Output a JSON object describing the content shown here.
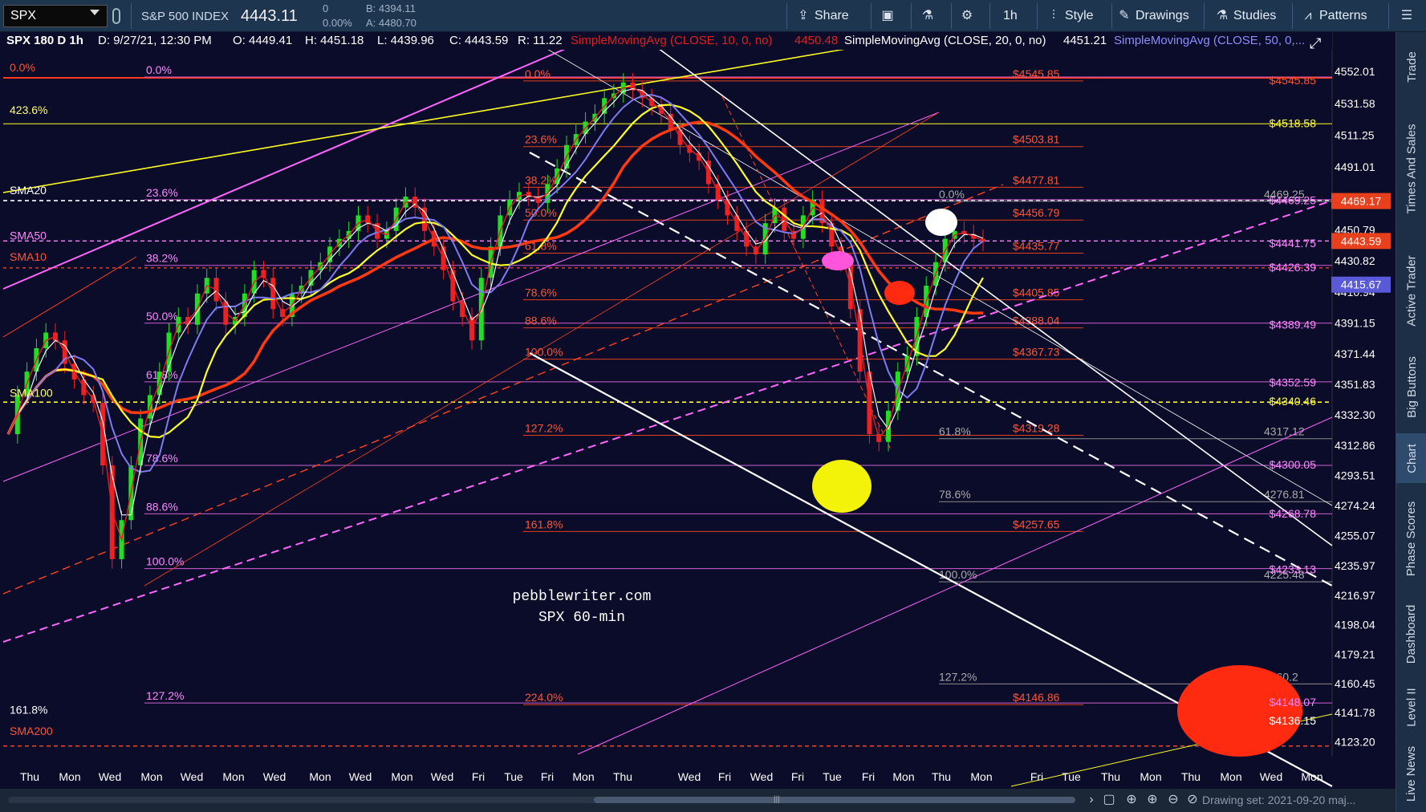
{
  "toolbar": {
    "symbol": "SPX",
    "index_name": "S&P 500 INDEX",
    "last_price": "4443.11",
    "change": "0",
    "change_pct": "0.00%",
    "bid": "B: 4394.11",
    "ask": "A: 4480.70",
    "buttons": {
      "share": "Share",
      "timeframe": "1h",
      "style": "Style",
      "drawings": "Drawings",
      "studies": "Studies",
      "patterns": "Patterns"
    }
  },
  "info_bar": {
    "study_label": "SPX 180 D 1h",
    "date": "D: 9/27/21, 12:30 PM",
    "open": "O: 4449.41",
    "high": "H: 4451.18",
    "low": "L: 4439.96",
    "close": "C: 4443.59",
    "range": "R: 11.22",
    "sma10": "SimpleMovingAvg (CLOSE, 10, 0, no)",
    "sma10_val": "4450.48",
    "sma20": "SimpleMovingAvg (CLOSE, 20, 0, no)",
    "sma20_val": "4451.21",
    "sma50": "SimpleMovingAvg (CLOSE, 50, 0,..."
  },
  "colors": {
    "background": "#0b0b2a",
    "price": "#e8e8e8",
    "sma10": "#e02020",
    "sma20": "#f4f4f4",
    "sma50": "#7c7cf0",
    "sma100": "#ffff22",
    "sma200": "#ff4010",
    "fib_orange": "#ff5522",
    "fib_pink": "#ff66ff",
    "fib_gray": "#9a9a9a",
    "channel_white": "#ffffff"
  },
  "chart_data": {
    "type": "candlestick",
    "title": "",
    "ylim": [
      4108,
      4567
    ],
    "y_ticks": [
      4552.01,
      4531.58,
      4511.25,
      4491.01,
      4470.86,
      4450.79,
      4430.82,
      4410.94,
      4391.15,
      4371.44,
      4351.83,
      4332.3,
      4312.86,
      4293.51,
      4274.24,
      4255.07,
      4235.97,
      4216.97,
      4198.04,
      4179.21,
      4160.45,
      4141.78,
      4123.2
    ],
    "x_labels": [
      "Thu",
      "Mon",
      "Wed",
      "Mon",
      "Wed",
      "Mon",
      "Wed",
      "Mon",
      "Wed",
      "Mon",
      "Wed",
      "Fri",
      "Tue",
      "Fri",
      "Mon",
      "Thu",
      "Wed",
      "Fri",
      "Wed",
      "Fri",
      "Tue",
      "Fri",
      "Mon",
      "Thu",
      "Mon",
      "Fri",
      "Tue",
      "Thu",
      "Mon",
      "Thu",
      "Mon",
      "Wed",
      "Mon"
    ],
    "price_tags": [
      {
        "label": "4469.17",
        "value": 4469.17,
        "color": "#e8401c"
      },
      {
        "label": "4443.59",
        "value": 4443.59,
        "color": "#e8401c"
      },
      {
        "label": "4415.67",
        "value": 4415.67,
        "color": "#5a5ad8"
      }
    ],
    "moving_averages": [
      {
        "name": "SMA10",
        "value": 4450.48
      },
      {
        "name": "SMA20",
        "value": 4451.21
      },
      {
        "name": "SMA50",
        "value": 4415.67
      }
    ],
    "horizontal_levels": [
      {
        "value": 4548,
        "color": "#ff3a1c",
        "width": 2,
        "dash": ""
      },
      {
        "value": 4518.58,
        "color": "#ffff22",
        "width": 1,
        "dash": ""
      },
      {
        "value": 4469.4,
        "color": "#ffffff",
        "width": 1.6,
        "dash": "5,4"
      },
      {
        "value": 4443.6,
        "color": "#ff88ff",
        "width": 1.4,
        "dash": "5,4"
      },
      {
        "value": 4426.4,
        "color": "#ff4a2a",
        "width": 1.2,
        "dash": "4,4"
      },
      {
        "value": 4340.46,
        "color": "#ffff22",
        "width": 1.6,
        "dash": "5,4"
      },
      {
        "value": 4120.4,
        "color": "#ff4a2a",
        "width": 1.4,
        "dash": "5,4"
      }
    ],
    "left_labels": [
      {
        "text": "0.0%",
        "value": 4552.0,
        "color": "#ff5533"
      },
      {
        "text": "423.6%",
        "value": 4525.0,
        "color": "#ffff66"
      },
      {
        "text": "SMA20",
        "value": 4473.5,
        "color": "#ffffff"
      },
      {
        "text": "SMA50",
        "value": 4444.5,
        "color": "#ff88ff"
      },
      {
        "text": "SMA10",
        "value": 4431.0,
        "color": "#ff5533"
      },
      {
        "text": "SMA100",
        "value": 4344.0,
        "color": "#ffff66"
      },
      {
        "text": "161.8%",
        "value": 4141.0,
        "color": "#ffffff"
      },
      {
        "text": "SMA200",
        "value": 4127.5,
        "color": "#ff5533"
      }
    ],
    "fib_pink": [
      {
        "pct": "0.0%",
        "value": 4548.5
      },
      {
        "pct": "23.6%",
        "value": 4470.0
      },
      {
        "pct": "38.2%",
        "value": 4428.0
      },
      {
        "pct": "50.0%",
        "value": 4391.0
      },
      {
        "pct": "61.8%",
        "value": 4353.5
      },
      {
        "pct": "78.6%",
        "value": 4300.0
      },
      {
        "pct": "88.6%",
        "value": 4269.0
      },
      {
        "pct": "100.0%",
        "value": 4234.0
      },
      {
        "pct": "127.2%",
        "value": 4148.0
      }
    ],
    "fib_orange": [
      {
        "pct": "0.0%",
        "value": 4546.0,
        "price": "$4545.85"
      },
      {
        "pct": "23.6%",
        "value": 4504.0,
        "price": "$4503.81"
      },
      {
        "pct": "38.2%",
        "value": 4478.0,
        "price": "$4477.81"
      },
      {
        "pct": "50.0%",
        "value": 4457.0,
        "price": "$4456.79"
      },
      {
        "pct": "61.8%",
        "value": 4435.8,
        "price": "$4435.77"
      },
      {
        "pct": "78.6%",
        "value": 4406.0,
        "price": "$4405.85"
      },
      {
        "pct": "88.6%",
        "value": 4388.0,
        "price": "$4388.04"
      },
      {
        "pct": "100.0%",
        "value": 4368.0,
        "price": "$4367.73"
      },
      {
        "pct": "127.2%",
        "value": 4319.3,
        "price": "$4319.28"
      },
      {
        "pct": "161.8%",
        "value": 4257.7,
        "price": "$4257.65"
      },
      {
        "pct": "224.0%",
        "value": 4146.9,
        "price": "$4146.86"
      }
    ],
    "fib_gray": [
      {
        "pct": "0.0%",
        "value": 4469.0,
        "price": "4469.25"
      },
      {
        "pct": "61.8%",
        "value": 4317.1,
        "price": "4317.12"
      },
      {
        "pct": "78.6%",
        "value": 4276.8,
        "price": "4276.81"
      },
      {
        "pct": "100.0%",
        "value": 4225.5,
        "price": "4225.48"
      },
      {
        "pct": "127.2%",
        "value": 4160.2,
        "price": "4160.2"
      }
    ],
    "right_prices": [
      {
        "text": "$4545.85",
        "value": 4546.0,
        "color": "#ff5533"
      },
      {
        "text": "$4518.58",
        "value": 4518.6,
        "color": "#ffff44"
      },
      {
        "text": "$4469.25",
        "value": 4469.3,
        "color": "#ff88ff"
      },
      {
        "text": "$4441.75",
        "value": 4441.8,
        "color": "#ff88ff"
      },
      {
        "text": "$4426.39",
        "value": 4426.4,
        "color": "#ff88ff"
      },
      {
        "text": "$4389.49",
        "value": 4389.5,
        "color": "#ff88ff"
      },
      {
        "text": "$4352.59",
        "value": 4352.6,
        "color": "#ff88ff"
      },
      {
        "text": "$4340.46",
        "value": 4340.5,
        "color": "#ffff44"
      },
      {
        "text": "$4300.05",
        "value": 4300.0,
        "color": "#ff88ff"
      },
      {
        "text": "$4268.78",
        "value": 4268.8,
        "color": "#ff88ff"
      },
      {
        "text": "$4233.13",
        "value": 4233.1,
        "color": "#ff88ff"
      },
      {
        "text": "$4148.07",
        "value": 4148.1,
        "color": "#ff88ff"
      },
      {
        "text": "$4136.15",
        "value": 4136.2,
        "color": "#ffffff"
      }
    ],
    "annotation": [
      "pebblewriter.com",
      "SPX 60-min"
    ],
    "price_series": [
      4320,
      4345,
      4360,
      4375,
      4385,
      4380,
      4365,
      4355,
      4345,
      4340,
      4300,
      4240,
      4265,
      4300,
      4330,
      4345,
      4360,
      4385,
      4395,
      4390,
      4410,
      4420,
      4405,
      4390,
      4395,
      4410,
      4425,
      4420,
      4400,
      4395,
      4410,
      4415,
      4425,
      4430,
      4440,
      4445,
      4450,
      4460,
      4455,
      4445,
      4450,
      4465,
      4472,
      4465,
      4450,
      4440,
      4425,
      4405,
      4395,
      4380,
      4420,
      4440,
      4460,
      4470,
      4475,
      4472,
      4468,
      4480,
      4490,
      4505,
      4512,
      4520,
      4525,
      4535,
      4538,
      4545,
      4540,
      4535,
      4530,
      4525,
      4515,
      4505,
      4500,
      4495,
      4480,
      4470,
      4460,
      4450,
      4440,
      4435,
      4455,
      4465,
      4450,
      4445,
      4460,
      4470,
      4455,
      4440,
      4430,
      4400,
      4360,
      4320,
      4315,
      4335,
      4360,
      4370,
      4395,
      4415,
      4430,
      4445,
      4450,
      4448,
      4445,
      4443
    ]
  },
  "right_panel": {
    "tabs": [
      "Trade",
      "Times And Sales",
      "Active Trader",
      "Big Buttons",
      "Chart",
      "Phase Scores",
      "Dashboard",
      "Level II",
      "Live News"
    ],
    "active": "Chart"
  },
  "bottom_bar": {
    "drawing_set": "Drawing set: 2021-09-20 maj..."
  }
}
